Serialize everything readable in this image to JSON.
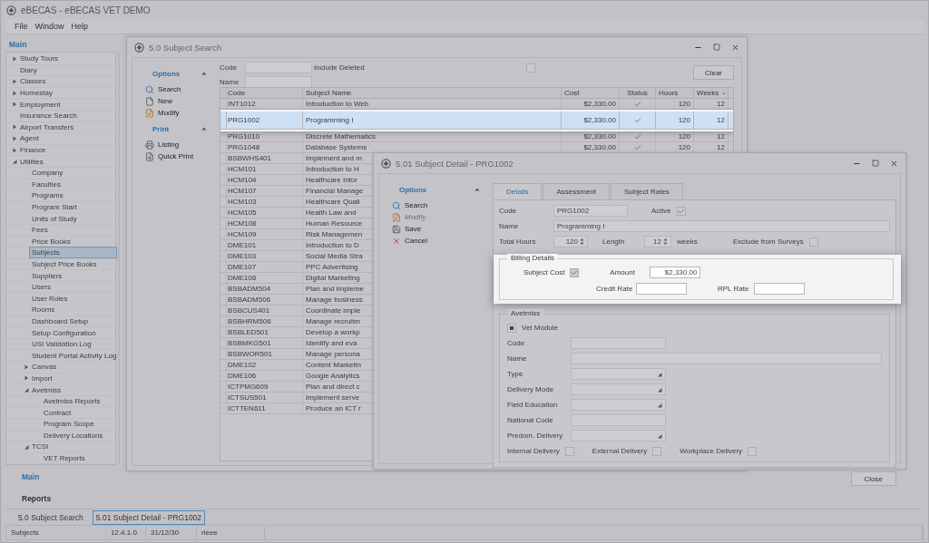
{
  "app": {
    "title": "eBECAS - eBECAS VET DEMO"
  },
  "menu": [
    "File",
    "Window",
    "Help"
  ],
  "sidebar": {
    "heading": "Main",
    "items": [
      {
        "label": "Study Tours",
        "expanded": false,
        "selected": false
      },
      {
        "label": "Diary",
        "selected": false
      },
      {
        "label": "Classes",
        "expanded": false,
        "selected": false
      },
      {
        "label": "Homestay",
        "expanded": false,
        "selected": false
      },
      {
        "label": "Employment",
        "expanded": false,
        "selected": false
      },
      {
        "label": "Insurance Search",
        "selected": false
      },
      {
        "label": "Airport Transfers",
        "expanded": false,
        "selected": false
      },
      {
        "label": "Agent",
        "expanded": false,
        "selected": false
      },
      {
        "label": "Finance",
        "expanded": false,
        "selected": false
      },
      {
        "label": "Utilities",
        "expanded": true,
        "selected": false,
        "children": [
          {
            "label": "Company",
            "selected": false
          },
          {
            "label": "Faculties",
            "selected": false
          },
          {
            "label": "Programs",
            "selected": false
          },
          {
            "label": "Program Start",
            "selected": false
          },
          {
            "label": "Units of Study",
            "selected": false
          },
          {
            "label": "Fees",
            "selected": false
          },
          {
            "label": "Price Books",
            "selected": false
          },
          {
            "label": "Subjects",
            "selected": true
          },
          {
            "label": "Subject Price Books",
            "selected": false
          },
          {
            "label": "Suppliers",
            "selected": false
          },
          {
            "label": "Users",
            "selected": false
          },
          {
            "label": "User Roles",
            "selected": false
          },
          {
            "label": "Rooms",
            "selected": false
          },
          {
            "label": "Dashboard Setup",
            "selected": false
          },
          {
            "label": "Setup Configuration",
            "selected": false
          },
          {
            "label": "USI Validation Log",
            "selected": false
          },
          {
            "label": "Student Portal Activity Log",
            "selected": false
          },
          {
            "label": "Canvas",
            "expanded": false,
            "selected": false
          },
          {
            "label": "Import",
            "expanded": false,
            "selected": false
          },
          {
            "label": "Avetmiss",
            "expanded": true,
            "selected": false,
            "children": [
              {
                "label": "Avetmiss Reports",
                "selected": false
              },
              {
                "label": "Contract",
                "selected": false
              },
              {
                "label": "Program Scope",
                "selected": false
              },
              {
                "label": "Delivery Locations",
                "selected": false
              }
            ]
          },
          {
            "label": "TCSI",
            "expanded": true,
            "selected": false,
            "children": [
              {
                "label": "VET Reports",
                "selected": false
              }
            ]
          }
        ]
      }
    ],
    "sections": [
      {
        "label": "Main",
        "selected": true
      },
      {
        "label": "Reports",
        "selected": false
      }
    ]
  },
  "search_window": {
    "title": "5.0 Subject Search",
    "panels": [
      {
        "title": "Options",
        "expanded": true,
        "items": [
          {
            "label": "Search",
            "disabled": false
          },
          {
            "label": "New",
            "disabled": false
          },
          {
            "label": "Modify",
            "disabled": false
          }
        ]
      },
      {
        "title": "Print",
        "expanded": true,
        "items": [
          {
            "label": "Listing",
            "disabled": false
          },
          {
            "label": "Quick Print",
            "disabled": false
          }
        ]
      }
    ],
    "filters": {
      "code_label": "Code",
      "include_deleted_label": "Include Deleted",
      "include_deleted": false,
      "name_label": "Name",
      "clear_button": "Clear"
    },
    "table": {
      "columns": [
        "Code",
        "Subject Name",
        "Cost",
        "Status",
        "Hours",
        "Weeks"
      ],
      "rows": [
        {
          "code": "INT1012",
          "name": "Introduction to Web",
          "cost": "$2,330.00",
          "status": true,
          "hours": "120",
          "weeks": "12",
          "selected": false
        },
        {
          "code": "PRG1002",
          "name": "Programming I",
          "cost": "$2,330.00",
          "status": true,
          "hours": "120",
          "weeks": "12",
          "selected": true
        },
        {
          "code": "PRG1010",
          "name": "Discrete Mathematics",
          "cost": "$2,330.00",
          "status": true,
          "hours": "120",
          "weeks": "12",
          "selected": false
        },
        {
          "code": "PRG1048",
          "name": "Database Systems",
          "cost": "$2,330.00",
          "status": true,
          "hours": "120",
          "weeks": "12",
          "selected": false
        },
        {
          "code": "BSBWHS401",
          "name": "Implement and m",
          "selected": false
        },
        {
          "code": "HCM101",
          "name": "Introduction to H",
          "selected": false
        },
        {
          "code": "HCM104",
          "name": "Healthcare Infor",
          "selected": false
        },
        {
          "code": "HCM107",
          "name": "Financial Manage",
          "selected": false
        },
        {
          "code": "HCM103",
          "name": "Healthcare Quali",
          "selected": false
        },
        {
          "code": "HCM105",
          "name": "Health Law and",
          "selected": false
        },
        {
          "code": "HCM108",
          "name": "Human Resource",
          "selected": false
        },
        {
          "code": "HCM109",
          "name": "Risk Managemen",
          "selected": false
        },
        {
          "code": "DME101",
          "name": "Introduction to D",
          "selected": false
        },
        {
          "code": "DME103",
          "name": "Social Media Stra",
          "selected": false
        },
        {
          "code": "DME107",
          "name": "PPC Advertising",
          "selected": false
        },
        {
          "code": "DME108",
          "name": "Digital Marketing",
          "selected": false
        },
        {
          "code": "BSBADM504",
          "name": "Plan and impleme",
          "selected": false
        },
        {
          "code": "BSBADM506",
          "name": "Manage business",
          "selected": false
        },
        {
          "code": "BSBCUS401",
          "name": "Coordinate imple",
          "selected": false
        },
        {
          "code": "BSBHRM506",
          "name": "Manage recruitm",
          "selected": false
        },
        {
          "code": "BSBLED501",
          "name": "Develop a workp",
          "selected": false
        },
        {
          "code": "BSBMKG501",
          "name": "Identify and eva",
          "selected": false
        },
        {
          "code": "BSBWOR501",
          "name": "Manage persona",
          "selected": false
        },
        {
          "code": "DME102",
          "name": "Content Marketin",
          "selected": false
        },
        {
          "code": "DME106",
          "name": "Google Analytics",
          "selected": false
        },
        {
          "code": "ICTPMG609",
          "name": "Plan and direct c",
          "selected": false
        },
        {
          "code": "ICTSUS501",
          "name": "Implement serve",
          "selected": false
        },
        {
          "code": "ICTTEN611",
          "name": "Produce an ICT r",
          "selected": false
        }
      ]
    }
  },
  "detail_window": {
    "title": "5.01 Subject Detail - PRG1002",
    "panel": {
      "title": "Options",
      "expanded": true,
      "items": [
        {
          "label": "Search",
          "disabled": false
        },
        {
          "label": "Modify",
          "disabled": true
        },
        {
          "label": "Save",
          "disabled": false
        },
        {
          "label": "Cancel",
          "disabled": false
        }
      ]
    },
    "tabs": [
      {
        "label": "Details",
        "selected": true
      },
      {
        "label": "Assessment",
        "selected": false
      },
      {
        "label": "Subject Rates",
        "selected": false
      }
    ],
    "code": {
      "label": "Code",
      "value": "PRG1002"
    },
    "active": {
      "label": "Active",
      "checked": true
    },
    "name": {
      "label": "Name",
      "value": "Programming I"
    },
    "total_hours": {
      "label": "Total Hours",
      "value": "120"
    },
    "length": {
      "label": "Length",
      "value": "12",
      "unit": "weeks"
    },
    "exclude_from_surveys": {
      "label": "Exclude from Surveys",
      "checked": false
    },
    "billing": {
      "title": "Billing Details",
      "subject_cost": {
        "label": "Subject Cost",
        "checked": true
      },
      "amount": {
        "label": "Amount",
        "value": "$2,330.00"
      },
      "credit_rate": {
        "label": "Credit Rate"
      },
      "rpl_rate": {
        "label": "RPL Rate"
      }
    },
    "avetmiss": {
      "title": "Avetmiss",
      "vet_module": {
        "label": "Vet Module",
        "indeterminate": true
      },
      "fields": [
        {
          "label": "Code",
          "kind": "text"
        },
        {
          "label": "Name",
          "kind": "longtext"
        },
        {
          "label": "Type",
          "kind": "dropdown"
        },
        {
          "label": "Delivery Mode",
          "kind": "dropdown"
        },
        {
          "label": "Field Education",
          "kind": "dropdown"
        },
        {
          "label": "National Code",
          "kind": "text"
        },
        {
          "label": "Predom. Delivery",
          "kind": "dropdown"
        }
      ],
      "deliveries": [
        {
          "label": "Internal Delivery",
          "checked": false
        },
        {
          "label": "External Delivery",
          "checked": false
        },
        {
          "label": "Workplace Delivery",
          "checked": false
        }
      ]
    },
    "close_button": "Close"
  },
  "window_tabs": [
    {
      "label": "5.0 Subject Search",
      "selected": false
    },
    {
      "label": "5.01 Subject Detail - PRG1002",
      "selected": true
    }
  ],
  "status_bar": [
    "Subjects",
    "12.4.1.0",
    "31/12/30",
    "rleee"
  ]
}
